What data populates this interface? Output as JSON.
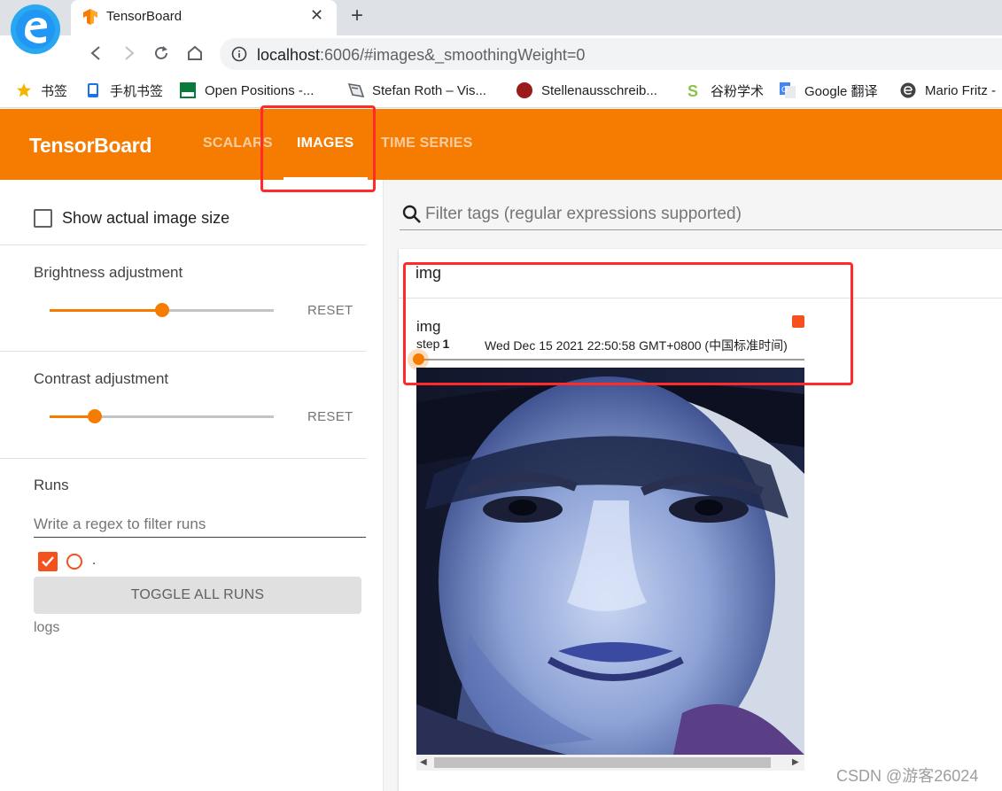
{
  "browser": {
    "tab_title": "TensorBoard",
    "tab_close": "✕",
    "new_tab": "+",
    "url_host": "localhost",
    "url_rest": ":6006/#images&_smoothingWeight=0",
    "bookmarks": [
      {
        "label": "书签",
        "icon": "star-icon",
        "color": "#f4b400"
      },
      {
        "label": "手机书签",
        "icon": "phone-icon",
        "color": "#1a73e8"
      },
      {
        "label": "Open Positions -...",
        "icon": "lmu-logo-icon",
        "color": "#0a7a3c"
      },
      {
        "label": "Stefan Roth – Vis...",
        "icon": "vision-logo-icon",
        "color": "#5f6368"
      },
      {
        "label": "Stellenausschreib...",
        "icon": "circle-red-icon",
        "color": "#9b1b1b"
      },
      {
        "label": "谷粉学术",
        "icon": "s-logo-icon",
        "color": "#8bc34a"
      },
      {
        "label": "Google 翻译",
        "icon": "translate-icon",
        "color": "#4285f4"
      },
      {
        "label": "Mario Fritz -",
        "icon": "e-logo-icon",
        "color": "#424242"
      }
    ]
  },
  "header": {
    "brand": "TensorBoard",
    "tabs": [
      {
        "label": "SCALARS",
        "active": false
      },
      {
        "label": "IMAGES",
        "active": true
      },
      {
        "label": "TIME SERIES",
        "active": false
      }
    ],
    "accent": "#f57c00"
  },
  "sidebar": {
    "show_actual_size_label": "Show actual image size",
    "show_actual_size_checked": false,
    "brightness": {
      "label": "Brightness adjustment",
      "reset": "RESET",
      "level": 0.5
    },
    "contrast": {
      "label": "Contrast adjustment",
      "reset": "RESET",
      "level": 0.2
    },
    "runs": {
      "label": "Runs",
      "filter_placeholder": "Write a regex to filter runs",
      "run_name": ".",
      "run_color": "#f4511e",
      "toggle_all": "TOGGLE ALL RUNS",
      "logdir": "logs"
    }
  },
  "main": {
    "tag_filter_placeholder": "Filter tags (regular expressions supported)",
    "tag_group": "img",
    "card": {
      "title": "img",
      "step_label": "step",
      "step_value": "1",
      "wall_time": "Wed Dec 15 2021 22:50:58 GMT+0800 (中国标准时间)",
      "image_description": "blue-tinted portrait of a sad face"
    }
  },
  "watermark": "CSDN @游客26024"
}
